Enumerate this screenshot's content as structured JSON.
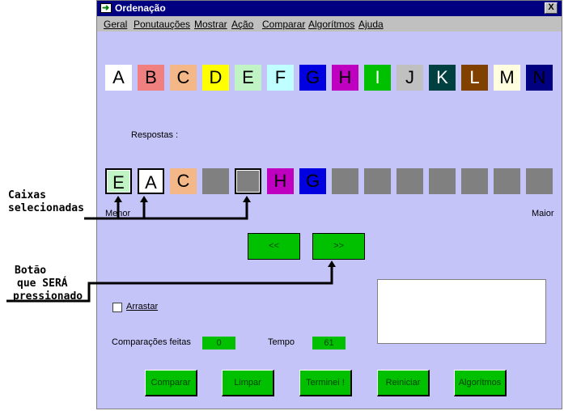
{
  "window": {
    "title": "Ordenação",
    "close_label": "X"
  },
  "menu": [
    "Geral",
    "Ponutauções",
    "Mostrar",
    "Ação",
    "Comparar",
    "Algorítmos",
    "Ajuda"
  ],
  "letters": [
    {
      "label": "A",
      "color": "#ffffff"
    },
    {
      "label": "B",
      "color": "#f08080"
    },
    {
      "label": "C",
      "color": "#f4b888"
    },
    {
      "label": "D",
      "color": "#ffff00"
    },
    {
      "label": "E",
      "color": "#c0f4c4"
    },
    {
      "label": "F",
      "color": "#c0ffff"
    },
    {
      "label": "G",
      "color": "#0000e0"
    },
    {
      "label": "H",
      "color": "#c000c0"
    },
    {
      "label": "I",
      "color": "#00c000"
    },
    {
      "label": "J",
      "color": "#c0c0c0"
    },
    {
      "label": "K",
      "color": "#004040"
    },
    {
      "label": "L",
      "color": "#804000"
    },
    {
      "label": "M",
      "color": "#ffffe0"
    },
    {
      "label": "N",
      "color": "#000080"
    }
  ],
  "answers_label": "Respostas :",
  "answers": [
    {
      "label": "E",
      "color": "#c0f4c4",
      "selected": true
    },
    {
      "label": "A",
      "color": "#ffffff",
      "selected": true
    },
    {
      "label": "C",
      "color": "#f4b888",
      "selected": false
    },
    {
      "label": "",
      "color": "#808080",
      "selected": false
    },
    {
      "label": "",
      "color": "#808080",
      "selected": true
    },
    {
      "label": "H",
      "color": "#c000c0",
      "selected": false
    },
    {
      "label": "G",
      "color": "#0000e0",
      "selected": false
    },
    {
      "label": "",
      "color": "#808080",
      "selected": false
    },
    {
      "label": "",
      "color": "#808080",
      "selected": false
    },
    {
      "label": "",
      "color": "#808080",
      "selected": false
    },
    {
      "label": "",
      "color": "#808080",
      "selected": false
    },
    {
      "label": "",
      "color": "#808080",
      "selected": false
    },
    {
      "label": "",
      "color": "#808080",
      "selected": false
    },
    {
      "label": "",
      "color": "#808080",
      "selected": false
    }
  ],
  "scale": {
    "min_label": "Menor",
    "max_label": "Maior"
  },
  "nav": {
    "prev_label": "<<",
    "next_label": ">>"
  },
  "drag": {
    "label": "Arrastar",
    "checked": false
  },
  "stats": {
    "comparisons_label": "Comparações feitas",
    "comparisons_value": "0",
    "time_label": "Tempo",
    "time_value": "61"
  },
  "buttons": {
    "compare": "Comparar",
    "clear": "Limpar",
    "done": "Terminei !",
    "restart": "Reiniciar",
    "algorithms": "Algorítmos"
  },
  "annotations": {
    "selected_boxes": [
      "Caixas",
      "selecionadas"
    ],
    "button_to_press": [
      "Botão",
      "que SERÁ",
      "pressionado"
    ]
  }
}
